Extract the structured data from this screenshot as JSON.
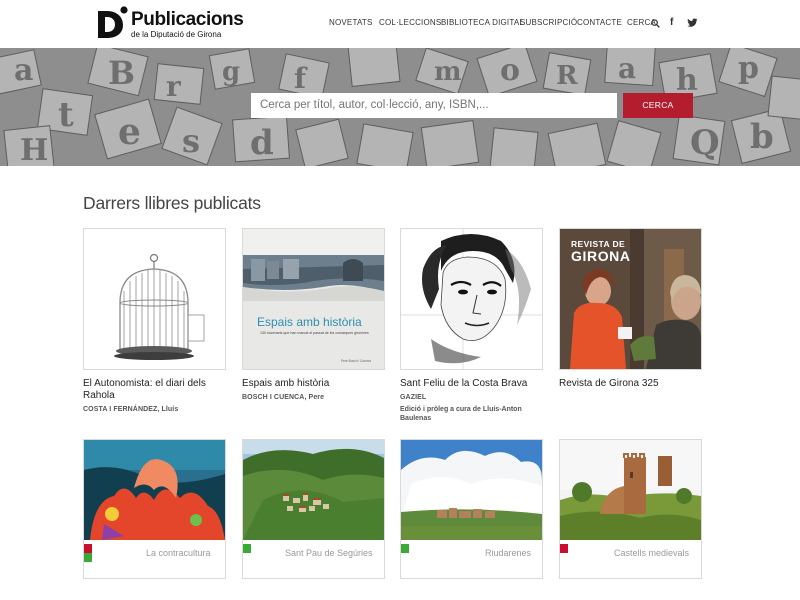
{
  "header": {
    "logo_title": "Publicacions",
    "logo_subtitle": "de la Diputació de Girona",
    "nav": [
      "NOVETATS",
      "COL·LECCIONS",
      "BIBLIOTECA DIGITAL",
      "SUBSCRIPCIÓ",
      "CONTACTE",
      "CERCA"
    ],
    "social_facebook": "f"
  },
  "hero": {
    "search_placeholder": "Cerca per títol, autor, col·lecció, any, ISBN,...",
    "search_button": "CERCA"
  },
  "main": {
    "section_title": "Darrers llibres publicats",
    "books": [
      {
        "title": "El Autonomista: el diari dels Rahola",
        "author": "COSTA I FERNÁNDEZ, Lluís"
      },
      {
        "title": "Espais amb història",
        "author": "BOSCH I CUENCA, Pere",
        "cover_title": "Espais amb història",
        "cover_subtitle": "130 escenaris que han marcat el passat de les comarques gironines",
        "cover_footer": "Pere Bosch i Cuenca"
      },
      {
        "title": "Sant Feliu de la Costa Brava",
        "author": "GAZIEL",
        "note": "Edició i pròleg a cura de Lluís-Anton Baulenas"
      },
      {
        "title": "Revista de Girona 325",
        "cover_title_1": "REVISTA DE",
        "cover_title_2": "GIRONA"
      },
      {
        "cover_title": "La contracultura"
      },
      {
        "cover_title": "Sant Pau de Segúries"
      },
      {
        "cover_title": "Riudarenes"
      },
      {
        "cover_title": "Castells medievals"
      }
    ]
  },
  "colors": {
    "accent": "#b41d2e",
    "collection_red": "#c8102e",
    "collection_green": "#3aa935"
  }
}
